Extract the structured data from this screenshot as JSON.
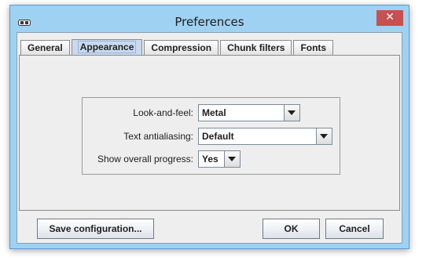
{
  "window": {
    "title": "Preferences",
    "close_symbol": "✕",
    "app_icon": "app-icon"
  },
  "tabs": [
    {
      "label": "General",
      "selected": false
    },
    {
      "label": "Appearance",
      "selected": true
    },
    {
      "label": "Compression",
      "selected": false
    },
    {
      "label": "Chunk filters",
      "selected": false
    },
    {
      "label": "Fonts",
      "selected": false
    }
  ],
  "appearance": {
    "look_and_feel": {
      "label": "Look-and-feel:",
      "value": "Metal"
    },
    "text_antialiasing": {
      "label": "Text antialiasing:",
      "value": "Default"
    },
    "show_overall_progress": {
      "label": "Show overall progress:",
      "value": "Yes"
    }
  },
  "buttons": {
    "save_configuration": "Save configuration...",
    "ok": "OK",
    "cancel": "Cancel"
  },
  "colors": {
    "title_bar": "#9fd1f2",
    "close_button": "#c75050",
    "panel_background": "#eeeeee",
    "selected_tab": "#c8daf0"
  }
}
